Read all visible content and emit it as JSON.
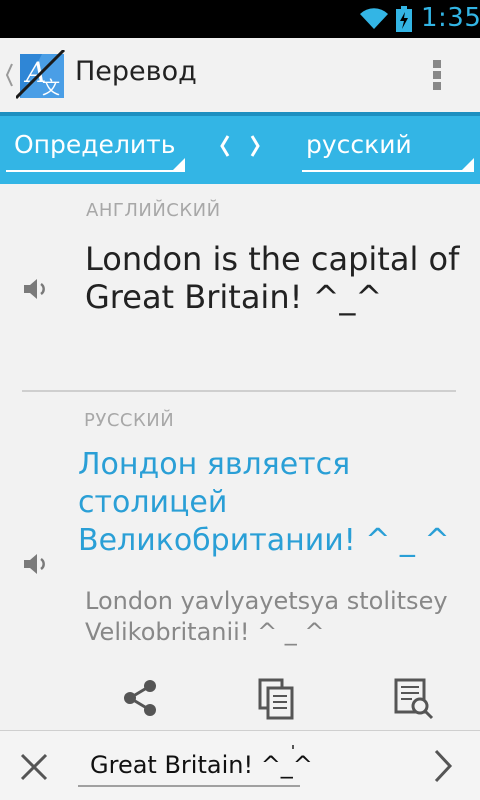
{
  "status_bar": {
    "time": "1:35",
    "icons": [
      "wifi-icon",
      "battery-charging-icon"
    ]
  },
  "action_bar": {
    "title": "Перевод",
    "logo_icon": "translate-app-icon",
    "menu_icon": "overflow-menu-icon"
  },
  "language_bar": {
    "source_language": "Определить",
    "target_language": "русский",
    "swap_icon": "swap-languages-icon",
    "accent_color": "#33b5e5"
  },
  "source": {
    "language_label": "АНГЛИЙСКИЙ",
    "text": "London is the capital of Great Britain! ^_^",
    "speaker_icon": "speaker-icon"
  },
  "translation": {
    "language_label": "РУССКИЙ",
    "text": "Лондон является столицей Великобритании!  ^ _ ^",
    "transliteration": "London yavlyayetsya stolitsey Velikobritanii!  ^ _ ^",
    "speaker_icon": "speaker-icon",
    "text_color": "#2a9fd6"
  },
  "actions": {
    "icons": [
      "share-icon",
      "copy-icon",
      "dictionary-search-icon"
    ]
  },
  "input_bar": {
    "value": "Great Britain! ^_^",
    "clear_icon": "close-icon",
    "next_icon": "chevron-right-icon"
  }
}
